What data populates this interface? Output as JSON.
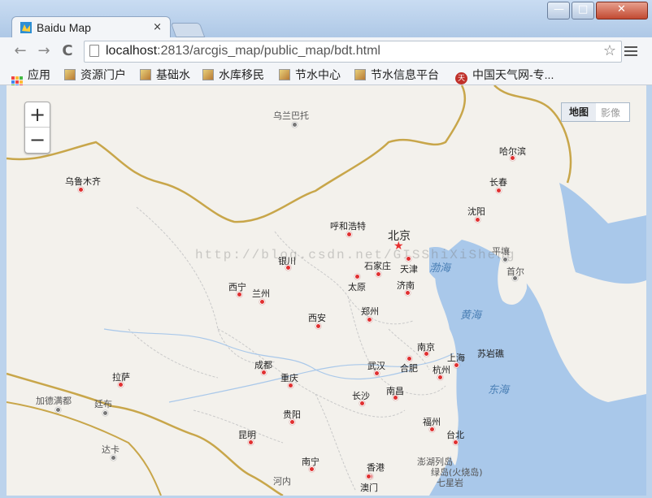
{
  "window": {
    "tab_title": "Baidu Map",
    "tab_close": "×",
    "minimize_glyph": "—",
    "maximize_glyph": "□",
    "close_glyph": "✕"
  },
  "toolbar": {
    "back_glyph": "←",
    "forward_glyph": "→",
    "reload_glyph": "C",
    "url_host": "localhost",
    "url_path": ":2813/arcgis_map/public_map/bdt.html",
    "star_glyph": "☆"
  },
  "bookmarks": {
    "apps_label": "应用",
    "items": [
      "资源门户",
      "基础水",
      "水库移民",
      "节水中心",
      "节水信息平台",
      "中国天气网-专..."
    ],
    "more_glyph": "»"
  },
  "map": {
    "zoom_in": "+",
    "zoom_out": "−",
    "type_map": "地图",
    "type_satellite": "影像",
    "watermark": "http://blog.csdn.net/GISShiXiSheng",
    "capital": "北京",
    "cities": [
      "乌兰巴托",
      "乌鲁木齐",
      "哈尔滨",
      "长春",
      "沈阳",
      "呼和浩特",
      "天津",
      "石家庄",
      "银川",
      "太原",
      "济南",
      "平壤",
      "首尔",
      "西宁",
      "兰州",
      "郑州",
      "西安",
      "南京",
      "上海",
      "合肥",
      "苏岩礁",
      "拉萨",
      "成都",
      "武汉",
      "重庆",
      "杭州",
      "加德满都",
      "廷布",
      "长沙",
      "南昌",
      "贵阳",
      "福州",
      "昆明",
      "台北",
      "达卡",
      "南宁",
      "香港",
      "河内",
      "澳门",
      "澎湖列岛",
      "绿岛(火烧岛)",
      "七星岩"
    ],
    "seas": [
      "渤海",
      "黄海",
      "东海"
    ]
  },
  "colors": {
    "land": "#f3f1ec",
    "water": "#a9c8ea",
    "border": "#c8a64a",
    "province": "#c9c9c9"
  }
}
